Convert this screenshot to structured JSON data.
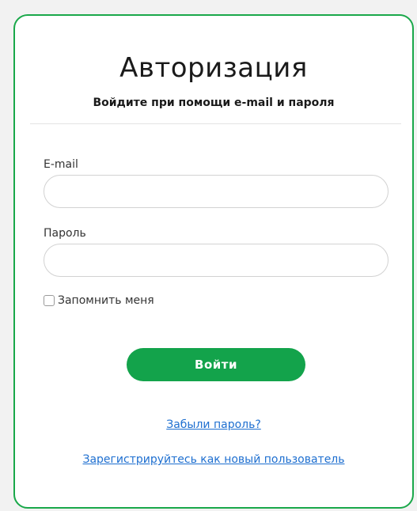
{
  "header": {
    "title": "Авторизация",
    "subtitle": "Войдите при помощи e-mail и пароля"
  },
  "form": {
    "email_label": "E-mail",
    "email_value": "",
    "password_label": "Пароль",
    "password_value": "",
    "remember_label": "Запомнить меня",
    "remember_checked": false,
    "submit_label": "Войти"
  },
  "links": {
    "forgot": "Забыли пароль?",
    "register": "Зарегистрируйтесь как новый пользователь"
  },
  "colors": {
    "accent": "#13a34b",
    "border": "#1aa84a",
    "link": "#1e6fd0"
  }
}
